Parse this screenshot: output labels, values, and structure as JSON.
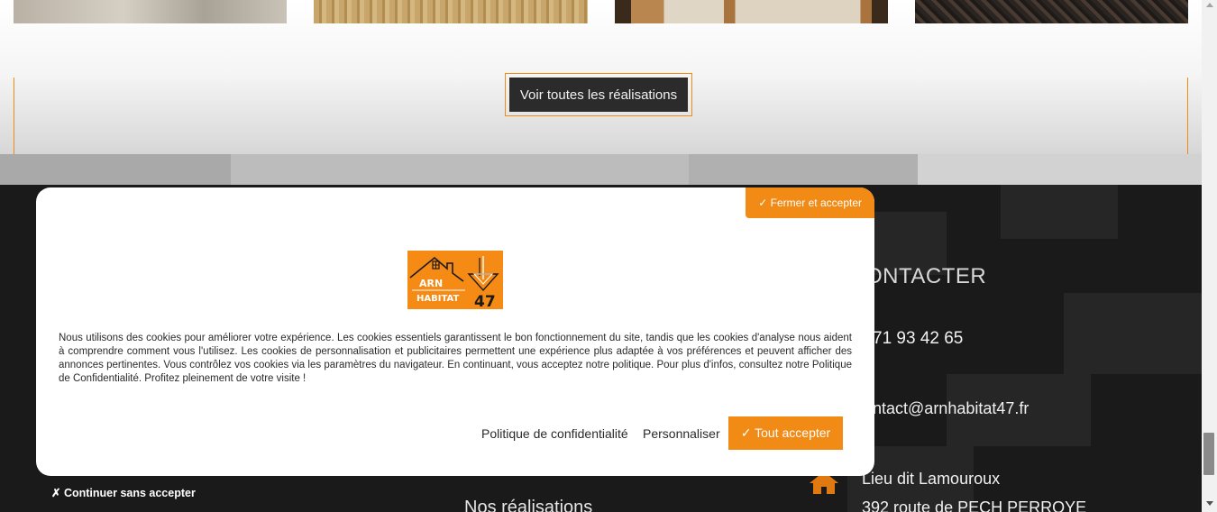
{
  "gallery": {
    "cta_label": "Voir toutes les réalisations"
  },
  "footer": {
    "contact_title": "ONTACTER",
    "phone": "71 93 42 65",
    "email": "ontact@arnhabitat47.fr",
    "address_line1": "Lieu dit Lamouroux",
    "address_line2": "392 route de PECH PERROYE",
    "nav_realisations": "Nos réalisations",
    "home_icon": "home-icon"
  },
  "cookie_banner": {
    "close_accept_label": "✓ Fermer et accepter",
    "logo": {
      "line1": "ARN",
      "line2": "HABITAT",
      "number": "47"
    },
    "text": "Nous utilisons des cookies pour améliorer votre expérience. Les cookies essentiels garantissent le bon fonctionnement du site, tandis que les cookies d'analyse nous aident à comprendre comment vous l'utilisez. Les cookies de personnalisation et publicitaires permettent une expérience plus adaptée à vos préférences et peuvent afficher des annonces pertinentes. Vous contrôlez vos cookies via les paramètres du navigateur. En continuant, vous acceptez notre politique. Pour plus d'infos, consultez notre Politique de Confidentialité. Profitez pleinement de votre visite !",
    "policy_label": "Politique de confidentialité",
    "customize_label": "Personnaliser",
    "accept_all_label": "✓ Tout accepter",
    "continue_label": "✗ Continuer sans accepter"
  },
  "colors": {
    "accent": "#f28a16",
    "footer_bg": "#1a1a1a",
    "button_dark": "#2b2b2b"
  }
}
